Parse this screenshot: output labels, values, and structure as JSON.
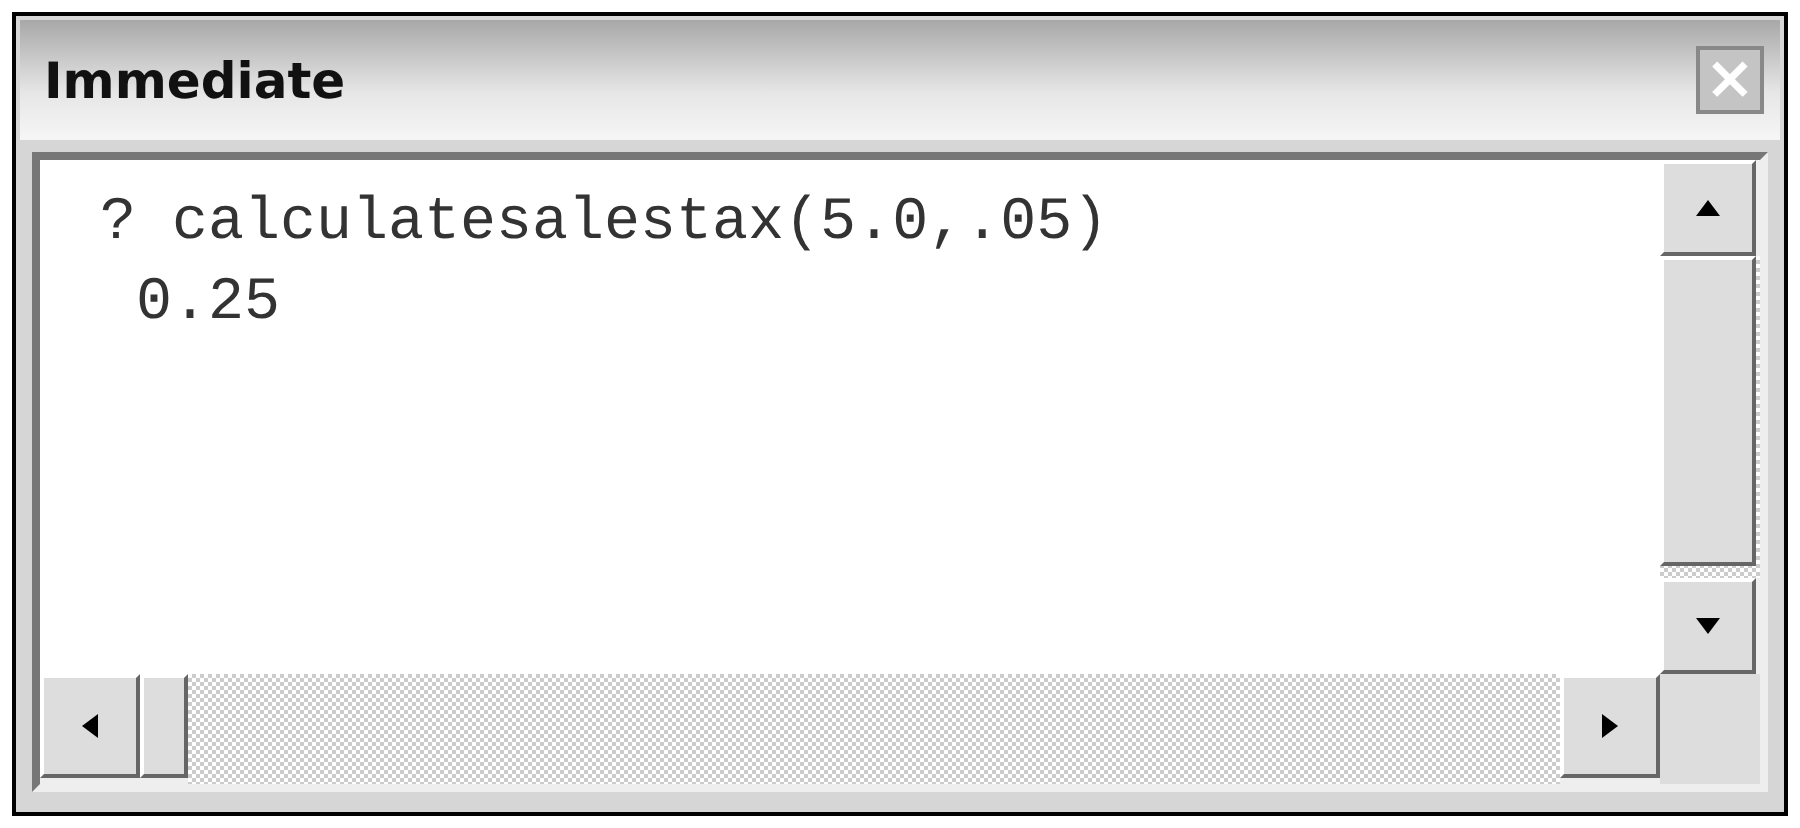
{
  "window": {
    "title": "Immediate",
    "close_glyph": "×"
  },
  "lines": [
    "? calculatesalestax(5.0,.05)",
    " 0.25"
  ]
}
